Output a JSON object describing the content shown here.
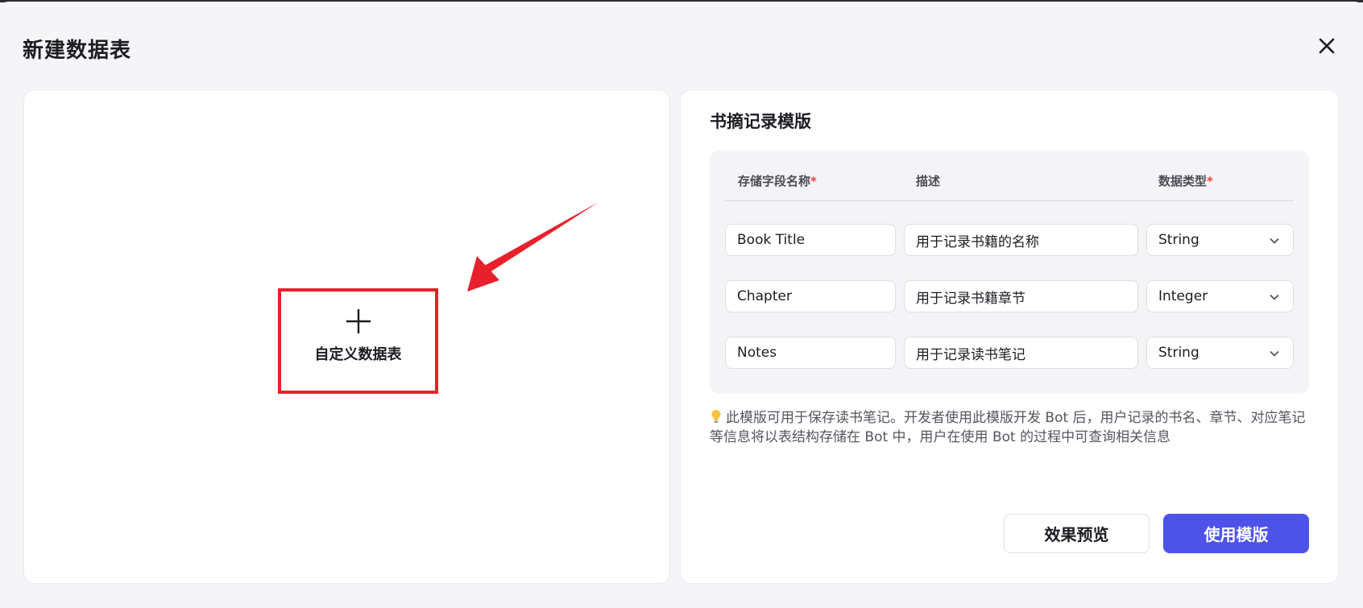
{
  "dialog": {
    "title": "新建数据表",
    "close_icon": "close-icon"
  },
  "custom": {
    "icon": "plus-icon",
    "label": "自定义数据表",
    "highlight_color": "#e8202b"
  },
  "template": {
    "title": "书摘记录模版",
    "headers": {
      "name": "存储字段名称",
      "desc": "描述",
      "type": "数据类型",
      "required_mark": "*"
    },
    "rows": [
      {
        "name": "Book Title",
        "desc": "用于记录书籍的名称",
        "type": "String"
      },
      {
        "name": "Chapter",
        "desc": "用于记录书籍章节",
        "type": "Integer"
      },
      {
        "name": "Notes",
        "desc": "用于记录读书笔记",
        "type": "String"
      }
    ],
    "note": "此模版可用于保存读书笔记。开发者使用此模版开发 Bot 后，用户记录的书名、章节、对应笔记等信息将以表结构存储在 Bot 中，用户在使用 Bot 的过程中可查询相关信息",
    "note_icon": "lightbulb-icon"
  },
  "actions": {
    "preview_label": "效果预览",
    "use_label": "使用模版",
    "accent_color": "#4d53e8"
  }
}
